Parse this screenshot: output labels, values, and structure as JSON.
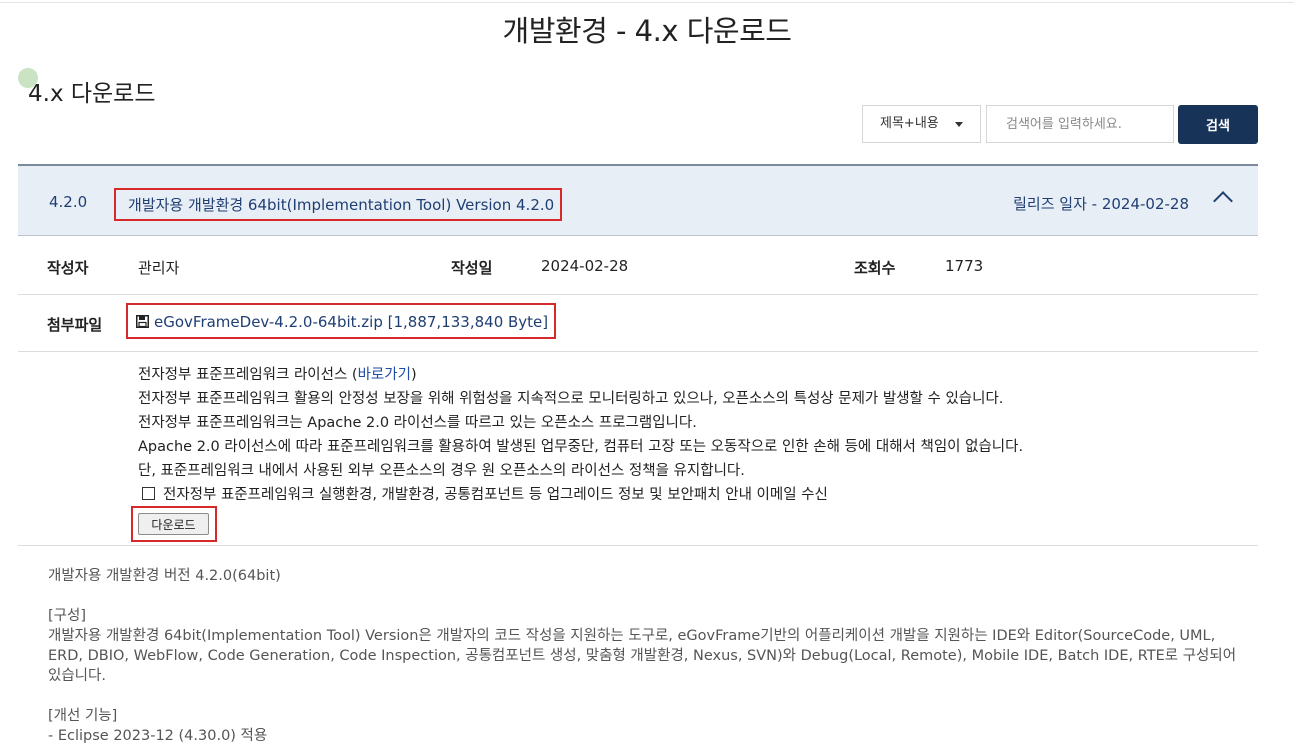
{
  "page": {
    "title": "개발환경 - 4.x 다운로드",
    "section_title": "4.x 다운로드"
  },
  "search": {
    "select_value": "제목+내용",
    "placeholder": "검색어를 입력하세요.",
    "button_label": "검색"
  },
  "item": {
    "version": "4.2.0",
    "title": "개발자용 개발환경 64bit(Implementation Tool) Version 4.2.0",
    "release": "릴리즈 일자 - 2024-02-28"
  },
  "info": {
    "author_label": "작성자",
    "author": "관리자",
    "date_label": "작성일",
    "date": "2024-02-28",
    "views_label": "조회수",
    "views": "1773"
  },
  "attachment": {
    "label": "첨부파일",
    "file": "eGovFrameDev-4.2.0-64bit.zip [1,887,133,840 Byte]",
    "icon": "floppy-icon"
  },
  "license": {
    "line1_prefix": "전자정부 표준프레임워크 라이선스 (",
    "line1_link": "바로가기",
    "line1_suffix": ")",
    "line2": "전자정부 표준프레임워크 활용의 안정성 보장을 위해 위험성을 지속적으로 모니터링하고 있으나, 오픈소스의 특성상 문제가 발생할 수 있습니다.",
    "line3": "전자정부 표준프레임워크는 Apache 2.0 라이선스를 따르고 있는 오픈소스 프로그램입니다.",
    "line4": "Apache 2.0 라이선스에 따라 표준프레임워크를 활용하여 발생된 업무중단, 컴퓨터 고장 또는 오동작으로 인한 손해 등에 대해서 책임이 없습니다.",
    "line5": "단, 표준프레임워크 내에서 사용된 외부 오픈소스의 경우 원 오픈소스의 라이선스 정책을 유지합니다.",
    "checkbox_label": "전자정부 표준프레임워크 실행환경, 개발환경, 공통컴포넌트 등 업그레이드 정보 및 보안패치 안내 이메일 수신",
    "download_label": "다운로드"
  },
  "description": {
    "summary": "개발자용 개발환경 버전 4.2.0(64bit)",
    "composition_heading": "[구성]",
    "composition_text": "개발자용 개발환경 64bit(Implementation Tool) Version은 개발자의 코드 작성을 지원하는 도구로, eGovFrame기반의 어플리케이션 개발을 지원하는 IDE와 Editor(SourceCode, UML, ERD, DBIO, WebFlow, Code Generation, Code Inspection, 공통컴포넌트 생성, 맞춤형 개발환경, Nexus, SVN)와 Debug(Local, Remote), Mobile IDE, Batch IDE, RTE로 구성되어 있습니다.",
    "improvements_heading": "[개선 기능]",
    "improvements_first": "- Eclipse 2023-12 (4.30.0) 적용"
  }
}
